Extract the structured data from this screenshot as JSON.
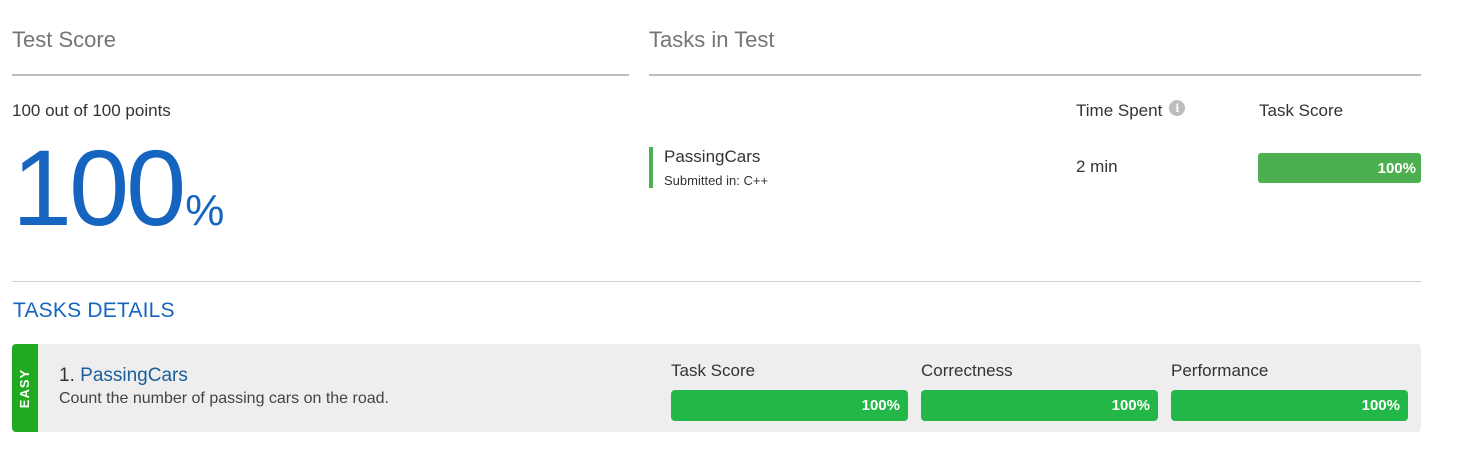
{
  "test_score": {
    "title": "Test Score",
    "points_text": "100 out of 100 points",
    "percent_value": "100",
    "percent_sign": "%"
  },
  "tasks_in_test": {
    "title": "Tasks in Test",
    "time_spent_header": "Time Spent",
    "info_icon_glyph": "i",
    "task_score_header": "Task Score",
    "tasks": [
      {
        "name": "PassingCars",
        "submitted": "Submitted in: C++",
        "time_spent": "2 min",
        "score_label": "100%",
        "score": 100
      }
    ]
  },
  "tasks_details": {
    "title": "TASKS DETAILS",
    "items": [
      {
        "difficulty": "EASY",
        "number": "1.",
        "name": "PassingCars",
        "description": "Count the number of passing cars on the road.",
        "metrics": [
          {
            "label": "Task Score",
            "value_label": "100%",
            "value": 100
          },
          {
            "label": "Correctness",
            "value_label": "100%",
            "value": 100
          },
          {
            "label": "Performance",
            "value_label": "100%",
            "value": 100
          }
        ]
      }
    ]
  },
  "colors": {
    "primary_blue": "#1565c0",
    "task_link": "#1a5f9a",
    "score_green": "#4caf50",
    "metric_green": "#22b747",
    "easy_green": "#1faa1f",
    "card_bg": "#eeeeee"
  }
}
